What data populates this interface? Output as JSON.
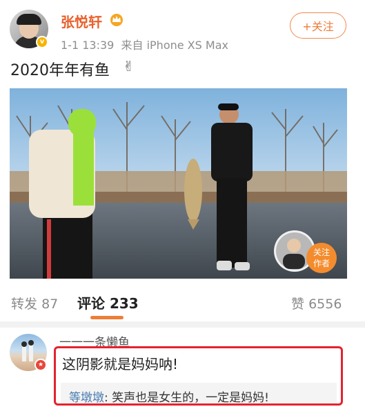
{
  "post": {
    "author": "张悦轩",
    "time": "1-1 13:39",
    "source": "来自 iPhone XS Max",
    "follow_label": "+关注",
    "text": "2020年年有鱼",
    "hand_icon": "victory-hand-icon",
    "crown_icon": "crown-icon"
  },
  "photo": {
    "overlay_follow": "关注",
    "overlay_author": "作者"
  },
  "stats": {
    "reposts_label": "转发",
    "reposts_count": "87",
    "comments_label": "评论",
    "comments_count": "233",
    "likes_label": "赞",
    "likes_count": "6556"
  },
  "comment": {
    "username": "一一一条懒鱼",
    "text": "这阴影就是妈妈呐!",
    "reply_user": "等墩墩",
    "reply_text": ": 笑声也是女生的，一定是妈妈!"
  },
  "colors": {
    "accent": "#ef7d35",
    "author_name": "#e8612c",
    "highlight": "#e5222e",
    "reply_name": "#4a7cb0"
  }
}
